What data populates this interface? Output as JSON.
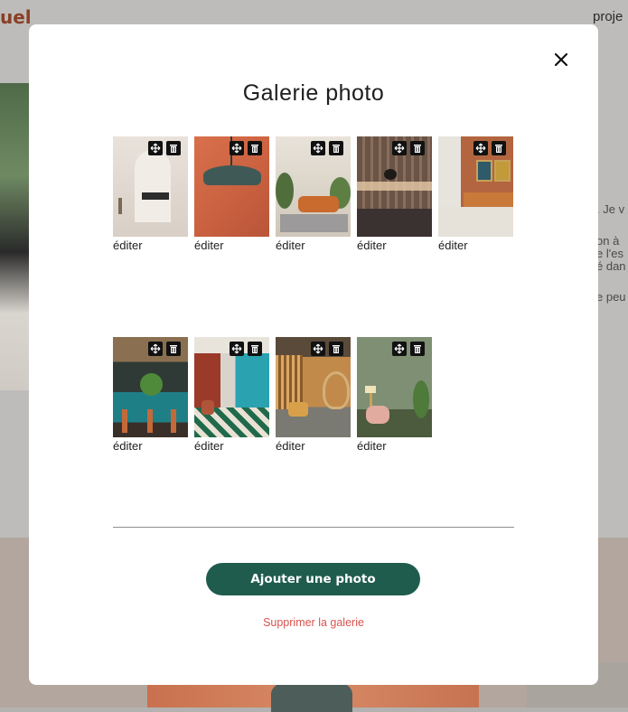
{
  "background": {
    "logo_text": "uel",
    "nav_item": "proje",
    "text_lines": [
      ". Je v",
      "on à",
      "e l'es",
      "é dan",
      "e peu"
    ]
  },
  "modal": {
    "title": "Galerie photo",
    "close_icon": "close-icon",
    "photos": [
      {
        "edit_label": "éditer",
        "subject": "minimal white room with bench"
      },
      {
        "edit_label": "éditer",
        "subject": "teal pendant lamp on terracotta wall"
      },
      {
        "edit_label": "éditer",
        "subject": "living room with orange sofa and plants"
      },
      {
        "edit_label": "éditer",
        "subject": "wood-slat wall with wall lamp"
      },
      {
        "edit_label": "éditer",
        "subject": "bedroom with orange wall and framed art"
      },
      {
        "edit_label": "éditer",
        "subject": "teal bar with stools"
      },
      {
        "edit_label": "éditer",
        "subject": "long restaurant hall with checkered floor"
      },
      {
        "edit_label": "éditer",
        "subject": "lounge with wicker hanging chair"
      },
      {
        "edit_label": "éditer",
        "subject": "green room with pink armchair"
      }
    ],
    "move_icon": "move-icon",
    "trash_icon": "trash-icon",
    "add_button_label": "Ajouter une photo",
    "delete_gallery_label": "Supprimer la galerie",
    "accent_color": "#1f5c4e",
    "danger_color": "#d9534f"
  }
}
